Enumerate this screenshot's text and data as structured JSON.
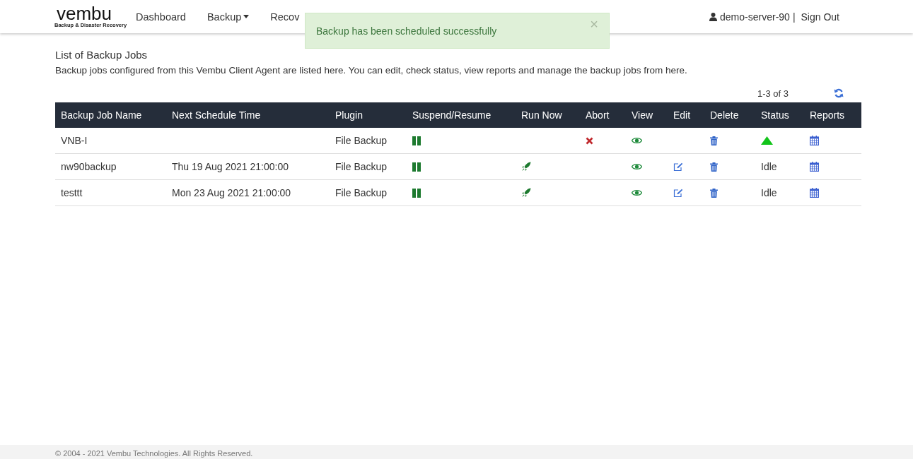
{
  "header": {
    "logo": "vembu",
    "logo_tagline": "Backup & Disaster Recovery",
    "nav": [
      {
        "label": "Dashboard",
        "dropdown": false
      },
      {
        "label": "Backup",
        "dropdown": true
      },
      {
        "label": "Recov",
        "dropdown": false
      }
    ],
    "user": "demo-server-90",
    "separator": "|",
    "sign_out": "Sign Out"
  },
  "toast": {
    "message": "Backup has been scheduled successfully",
    "close": "×"
  },
  "page": {
    "title": "List of Backup Jobs",
    "description": "Backup jobs configured from this Vembu Client Agent are listed here. You can edit, check status, view reports and manage the backup jobs from here.",
    "pagination": "1-3 of 3"
  },
  "table": {
    "columns": [
      "Backup Job Name",
      "Next Schedule Time",
      "Plugin",
      "Suspend/Resume",
      "Run Now",
      "Abort",
      "View",
      "Edit",
      "Delete",
      "Status",
      "Reports"
    ],
    "rows": [
      {
        "name": "VNB-I",
        "next_schedule": "",
        "plugin": "File Backup",
        "run_now": false,
        "abort": true,
        "edit": false,
        "status": {
          "kind": "running"
        }
      },
      {
        "name": "nw90backup",
        "next_schedule": "Thu 19 Aug 2021 21:00:00",
        "plugin": "File Backup",
        "run_now": true,
        "abort": false,
        "edit": true,
        "status": {
          "kind": "text",
          "text": "Idle"
        }
      },
      {
        "name": "testtt",
        "next_schedule": "Mon 23 Aug 2021 21:00:00",
        "plugin": "File Backup",
        "run_now": true,
        "abort": false,
        "edit": true,
        "status": {
          "kind": "text",
          "text": "Idle"
        }
      }
    ]
  },
  "footer": {
    "text": "© 2004 - 2021 Vembu Technologies. All Rights Reserved."
  }
}
